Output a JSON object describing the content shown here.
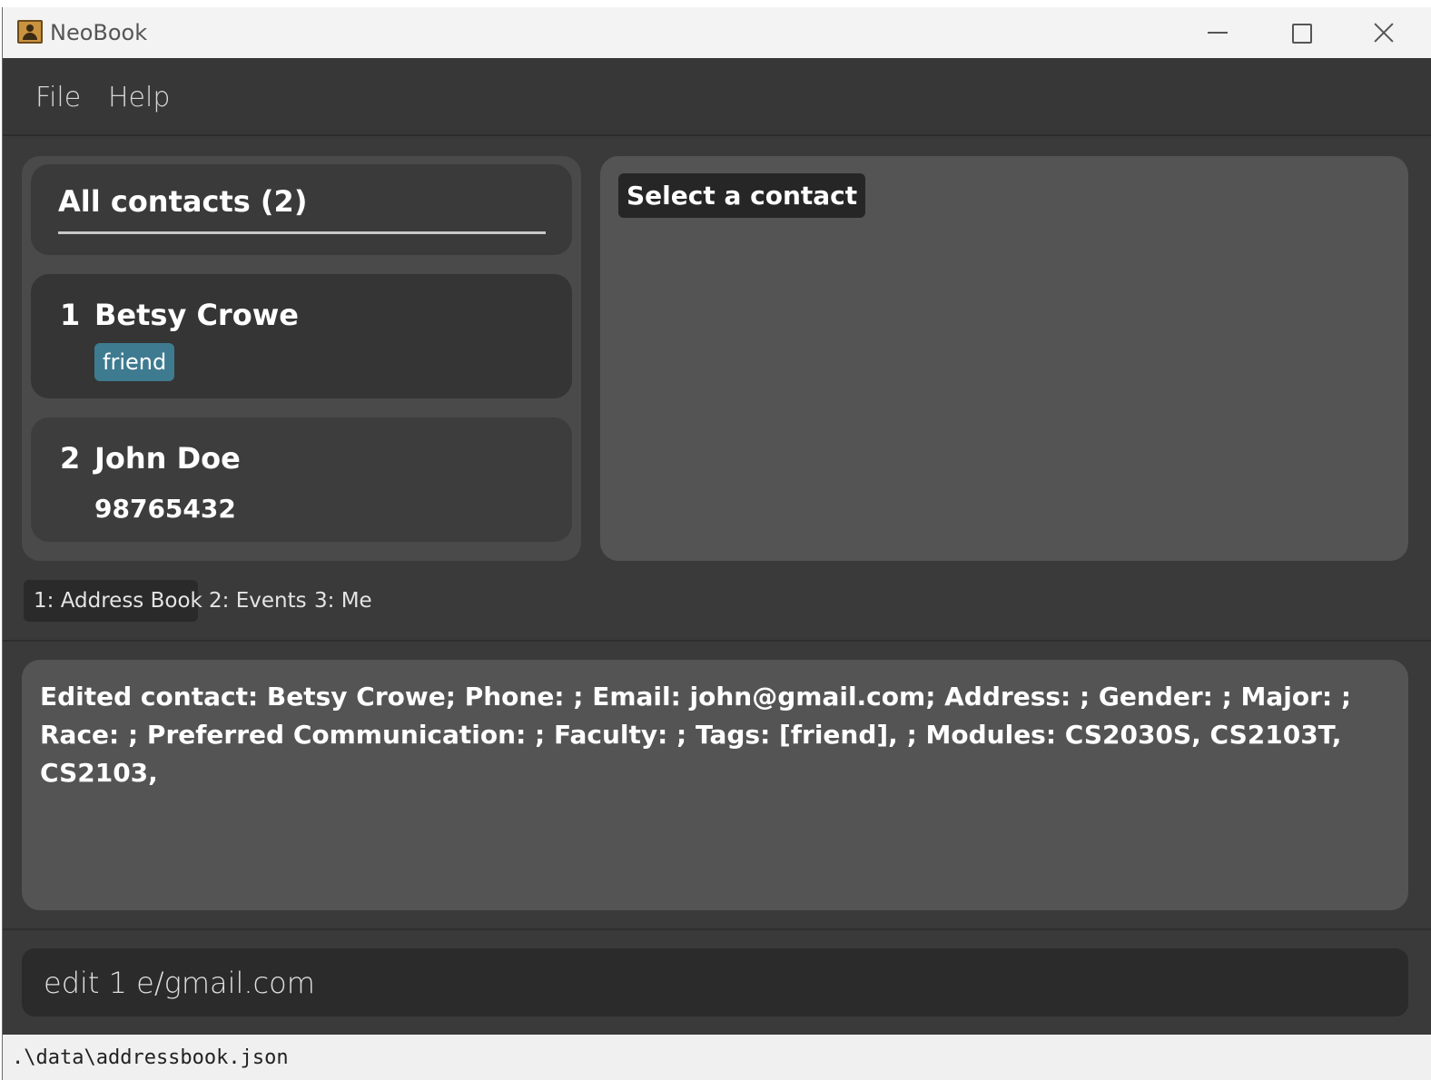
{
  "window": {
    "title": "NeoBook"
  },
  "menu": {
    "file_label": "File",
    "help_label": "Help"
  },
  "contact_list": {
    "title": "All contacts (2)",
    "contacts": [
      {
        "index": "1",
        "name": "Betsy Crowe",
        "tags": [
          "friend"
        ]
      },
      {
        "index": "2",
        "name": "John Doe",
        "phone": "98765432"
      }
    ]
  },
  "detail_panel": {
    "placeholder": "Select a contact"
  },
  "tabs": [
    {
      "label": "1: Address Book",
      "selected": true
    },
    {
      "label": "2: Events",
      "selected": false
    },
    {
      "label": "3: Me",
      "selected": false
    }
  ],
  "result_display": {
    "text": "Edited contact: Betsy Crowe; Phone: ; Email: john@gmail.com; Address: ; Gender: ; Major: ; Race: ; Preferred Communication: ; Faculty: ; Tags: [friend], ; Modules: CS2030S, CS2103T, CS2103,"
  },
  "command_box": {
    "value": "edit 1 e/gmail.com"
  },
  "status_bar": {
    "file_path": ".\\data\\addressbook.json"
  },
  "colors": {
    "tag_background": "#3e7b91",
    "window_background": "#3a3a3a",
    "panel_background": "#545454"
  }
}
